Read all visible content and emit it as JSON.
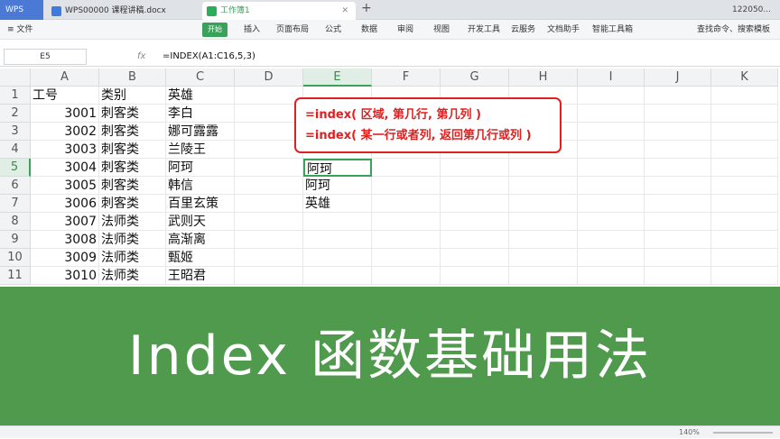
{
  "titlebar": {
    "logo": "WPS",
    "tabs": [
      {
        "label": "WPS00000 课程讲稿.docx",
        "active": false
      },
      {
        "label": "工作簿1",
        "active": true
      }
    ],
    "add_tab": "+",
    "account": "122050..."
  },
  "menubar": {
    "file": "≡ 文件",
    "start": "开始",
    "items": [
      "插入",
      "页面布局",
      "公式",
      "数据",
      "审阅",
      "视图",
      "开发工具",
      "云服务",
      "文档助手",
      "智能工具箱"
    ],
    "search": "查找命令、搜索模板"
  },
  "formula_bar": {
    "name_box": "E5",
    "fx": "fx",
    "formula": "=INDEX(A1:C16,5,3)"
  },
  "grid": {
    "columns": [
      "A",
      "B",
      "C",
      "D",
      "E",
      "F",
      "G",
      "H",
      "I",
      "J",
      "K"
    ],
    "selected_column": "E",
    "rows": [
      "1",
      "2",
      "3",
      "4",
      "5",
      "6",
      "7",
      "8",
      "9",
      "10",
      "11"
    ],
    "selected_row": "5",
    "data": [
      [
        "工号",
        "类别",
        "英雄"
      ],
      [
        "3001",
        "刺客类",
        "李白"
      ],
      [
        "3002",
        "刺客类",
        "娜可露露"
      ],
      [
        "3003",
        "刺客类",
        "兰陵王"
      ],
      [
        "3004",
        "刺客类",
        "阿珂"
      ],
      [
        "3005",
        "刺客类",
        "韩信"
      ],
      [
        "3006",
        "刺客类",
        "百里玄策"
      ],
      [
        "3007",
        "法师类",
        "武则天"
      ],
      [
        "3008",
        "法师类",
        "高渐离"
      ],
      [
        "3009",
        "法师类",
        "甄姬"
      ],
      [
        "3010",
        "法师类",
        "王昭君"
      ]
    ],
    "e_values": {
      "row5": "阿珂",
      "row6": "阿珂",
      "row7": "英雄"
    }
  },
  "annotation": {
    "line1": "=index( 区域, 第几行, 第几列 )",
    "line2": "=index( 某一行或者列, 返回第几行或列 )"
  },
  "banner": {
    "title": "Index 函数基础用法"
  },
  "status": {
    "zoom": "140%"
  }
}
